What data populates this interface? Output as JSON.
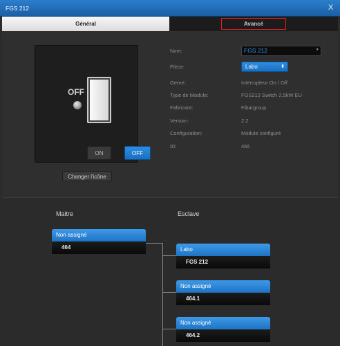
{
  "window": {
    "title": "FGS 212",
    "close_glyph": "X"
  },
  "tabs": [
    {
      "label": "Général",
      "active": true
    },
    {
      "label": "Avancé",
      "active": false
    }
  ],
  "switch": {
    "state_label": "OFF",
    "on_label": "ON",
    "off_label": "OFF",
    "change_icon_label": "Changer l'icône"
  },
  "props": {
    "name": {
      "label": "Nom:",
      "value": "FGS 212",
      "star": "*"
    },
    "room": {
      "label": "Pièce:",
      "value": "Labo",
      "arrow": "⬍"
    },
    "kind": {
      "label": "Genre:",
      "value": "Interrupteur On / Off"
    },
    "module_type": {
      "label": "Type de Module:",
      "value": "FGS212 Switch 2.5kW EU"
    },
    "maker": {
      "label": "Fabricant:",
      "value": "Fibargroup"
    },
    "version": {
      "label": "Version:",
      "value": "2.2"
    },
    "config": {
      "label": "Configuration:",
      "value": "Module configuré"
    },
    "id": {
      "label": "ID:",
      "value": "465"
    }
  },
  "association": {
    "master_title": "Maitre",
    "slave_title": "Esclave",
    "master": {
      "head": "Non assigné",
      "value": "464"
    },
    "slaves": [
      {
        "head": "Labo",
        "value": "FGS 212"
      },
      {
        "head": "Non assigné",
        "value": "464.1"
      },
      {
        "head": "Non assigné",
        "value": "464.2"
      }
    ]
  },
  "colors": {
    "accent": "#1e73c4",
    "highlight_border": "#e02020"
  }
}
